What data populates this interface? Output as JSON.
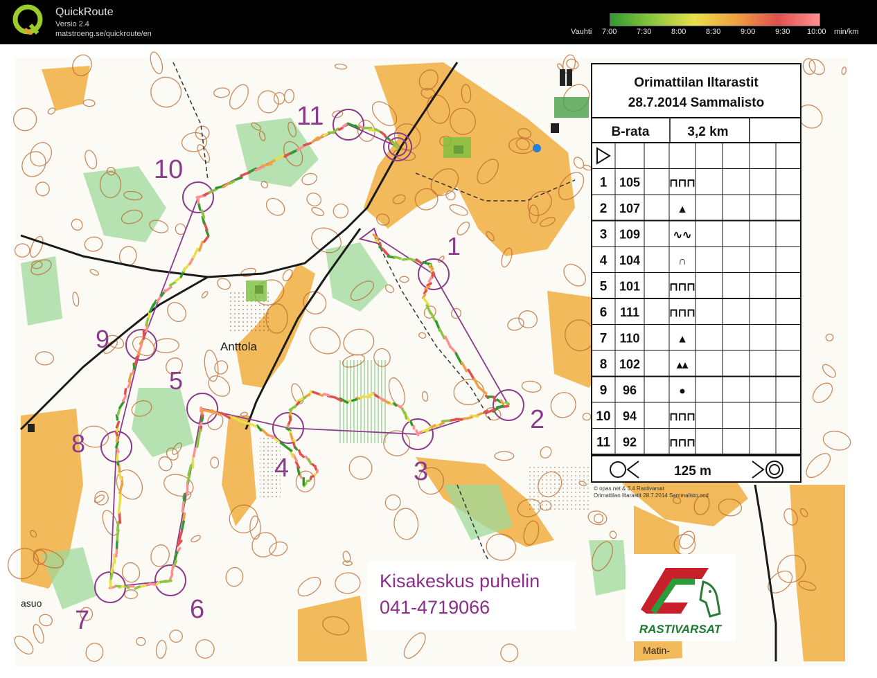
{
  "app": {
    "name": "QuickRoute",
    "version": "Versio 2.4",
    "url": "matstroeng.se/quickroute/en"
  },
  "pace_legend": {
    "label": "Vauhti",
    "unit": "min/km",
    "ticks": [
      "7:00",
      "7:30",
      "8:00",
      "8:30",
      "9:00",
      "9:30",
      "10:00"
    ],
    "gradient": [
      "#2f9a2f",
      "#8cc63f",
      "#e8e04a",
      "#f0a040",
      "#e05050",
      "#ff9090"
    ]
  },
  "course": {
    "event": "Orimattilan Iltarastit",
    "date_place": "28.7.2014 Sammalisto",
    "class": "B-rata",
    "length": "3,2 km",
    "controls": [
      {
        "num": "1",
        "code": "105",
        "feature": "⊓⊓⊓"
      },
      {
        "num": "2",
        "code": "107",
        "feature": "▲"
      },
      {
        "num": "3",
        "code": "109",
        "feature": "∿∿"
      },
      {
        "num": "4",
        "code": "104",
        "feature": "∩"
      },
      {
        "num": "5",
        "code": "101",
        "feature": "⊓⊓⊓"
      },
      {
        "num": "6",
        "code": "111",
        "feature": "⊓⊓⊓"
      },
      {
        "num": "7",
        "code": "110",
        "feature": "▲"
      },
      {
        "num": "8",
        "code": "102",
        "feature": "▴▴"
      },
      {
        "num": "9",
        "code": "96",
        "feature": "●"
      },
      {
        "num": "10",
        "code": "94",
        "feature": "⊓⊓⊓"
      },
      {
        "num": "11",
        "code": "92",
        "feature": "⊓⊓⊓"
      }
    ],
    "finish_distance": "125 m",
    "map_credit_1": "© opas.net & 3.4 Rastivarsat",
    "map_credit_2": "Orimattilan Iltarastit 28.7.2014 Sammalisto.ocd"
  },
  "map_labels": {
    "place_anttola": "Anttola",
    "place_asuo": "asuo",
    "place_matin": "Matin-"
  },
  "control_labels": [
    "1",
    "2",
    "3",
    "4",
    "5",
    "6",
    "7",
    "8",
    "9",
    "10",
    "11"
  ],
  "info": {
    "line1": "Kisakeskus puhelin",
    "line2": "041-4719066"
  },
  "club": {
    "name": "RASTIVARSAT"
  },
  "colors": {
    "course_purple": "#8a3b8c",
    "frame_blue": "#2a7fd4",
    "forest_white": "#ffffff",
    "open_land": "#f2b24a",
    "green_vegetation": "#8fcf8a",
    "contour_brown": "#b8652a"
  }
}
